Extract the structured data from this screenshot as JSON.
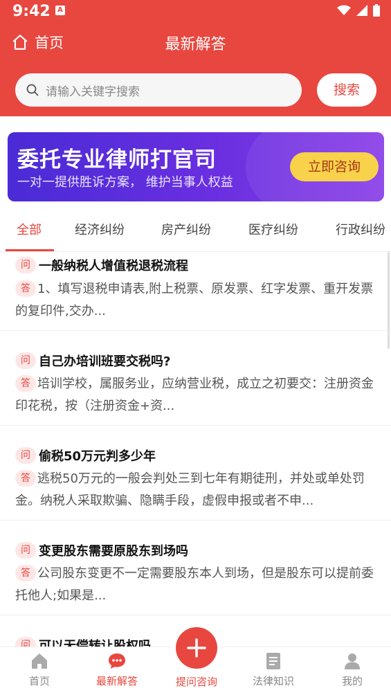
{
  "status_bar": {
    "time": "9:42",
    "notif_letter": "A"
  },
  "nav": {
    "home_label": "首页",
    "title": "最新解答"
  },
  "search": {
    "placeholder": "请输入关键字搜索",
    "button_label": "搜索"
  },
  "banner": {
    "title": "委托专业律师打官司",
    "subtitle": "一对一提供胜诉方案， 维护当事人权益",
    "button_label": "立即咨询"
  },
  "tabs": [
    {
      "label": "全部",
      "active": true
    },
    {
      "label": "经济纠纷",
      "active": false
    },
    {
      "label": "房产纠纷",
      "active": false
    },
    {
      "label": "医疗纠纷",
      "active": false
    },
    {
      "label": "行政纠纷",
      "active": false
    }
  ],
  "badges": {
    "question": "问",
    "answer": "答"
  },
  "questions": [
    {
      "title": "一般纳税人增值税退税流程",
      "answer": "1、填写退税申请表,附上税票、原发票、红字发票、重开发票的复印件,交办..."
    },
    {
      "title": "自己办培训班要交税吗?",
      "answer": "培训学校，属服务业，应纳营业税，成立之初要交：注册资金印花税，按（注册资金+资..."
    },
    {
      "title": "偷税50万元判多少年",
      "answer": "逃税50万元的一般会判处三到七年有期徒刑，并处或单处罚金。纳税人采取欺骗、隐瞒手段，虚假申报或者不申..."
    },
    {
      "title": "变更股东需要原股东到场吗",
      "answer": "公司股东变更不一定需要股东本人到场，但是股东可以提前委托他人;如果是..."
    },
    {
      "title": "可以无偿转让股权吗",
      "answer": ""
    }
  ],
  "bottom_nav": [
    {
      "label": "首页",
      "icon": "home-icon",
      "active": false
    },
    {
      "label": "最新解答",
      "icon": "chat-icon",
      "active": true
    },
    {
      "label": "提问咨询",
      "icon": "plus-icon",
      "active": false
    },
    {
      "label": "法律知识",
      "icon": "book-icon",
      "active": false
    },
    {
      "label": "我的",
      "icon": "user-icon",
      "active": false
    }
  ],
  "colors": {
    "brand_red": "#e8473f",
    "banner_purple": "#5b2ddb",
    "banner_button": "#f8d24a"
  }
}
